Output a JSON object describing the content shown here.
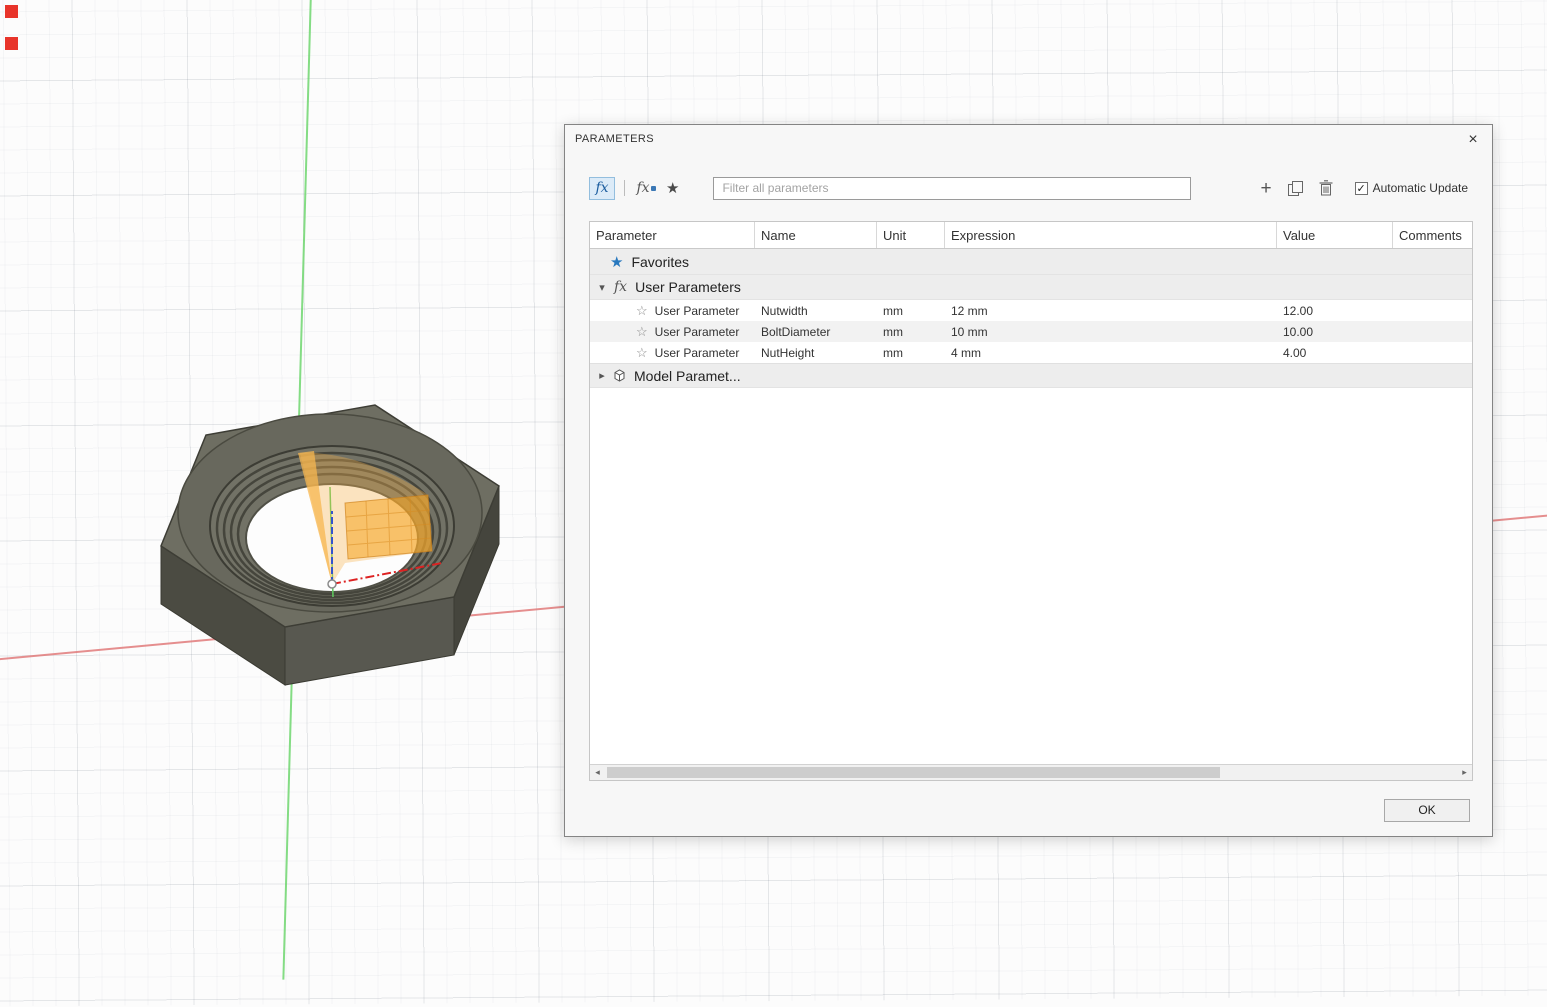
{
  "viewport": {
    "axis_x_color": "#e07a7a",
    "axis_y_color": "#6fd66f",
    "marker_color": "#e8342a"
  },
  "dialog": {
    "title": "PARAMETERS",
    "toolbar": {
      "filter_placeholder": "Filter all parameters",
      "automatic_update_label": "Automatic Update",
      "automatic_update_checked": true
    },
    "table": {
      "headers": [
        "Parameter",
        "Name",
        "Unit",
        "Expression",
        "Value",
        "Comments"
      ],
      "favorites_label": "Favorites",
      "user_parameters_label": "User Parameters",
      "model_parameters_label": "Model Paramet...",
      "rows": [
        {
          "parameter": "User Parameter",
          "name": "Nutwidth",
          "unit": "mm",
          "expression": "12 mm",
          "value": "12.00",
          "comments": ""
        },
        {
          "parameter": "User Parameter",
          "name": "BoltDiameter",
          "unit": "mm",
          "expression": "10 mm",
          "value": "10.00",
          "comments": ""
        },
        {
          "parameter": "User Parameter",
          "name": "NutHeight",
          "unit": "mm",
          "expression": "4 mm",
          "value": "4.00",
          "comments": ""
        }
      ]
    },
    "ok_label": "OK"
  },
  "icons": {
    "close": "×",
    "fx": "fx",
    "favorite_star": "★",
    "row_star": "☆",
    "plus": "+",
    "chevron_down": "▾",
    "chevron_right": "▸",
    "scroll_left": "◂",
    "scroll_right": "▸",
    "check": "✓"
  }
}
